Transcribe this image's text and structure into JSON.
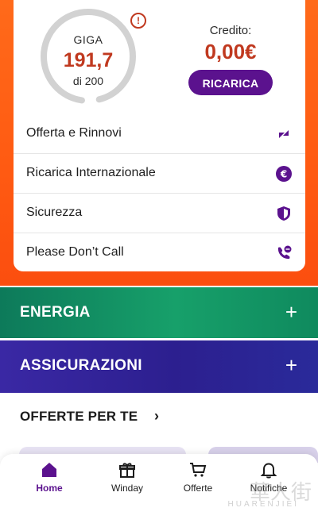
{
  "data_usage": {
    "label": "GIGA",
    "amount": "191,7",
    "total_label": "di 200",
    "used_fraction": 0.9585,
    "alert_icon": "alert-circle-icon"
  },
  "credit": {
    "label": "Credito:",
    "value": "0,00€",
    "button": "RICARICA"
  },
  "menu": [
    {
      "label": "Offerta e Rinnovi",
      "icon": "offer-renew-icon"
    },
    {
      "label": "Ricarica Internazionale",
      "icon": "euro-icon"
    },
    {
      "label": "Sicurezza",
      "icon": "shield-icon"
    },
    {
      "label": "Please Don’t Call",
      "icon": "phone-block-icon"
    }
  ],
  "sections": {
    "energy": {
      "title": "ENERGIA",
      "icon": "plus-icon"
    },
    "insurance": {
      "title": "ASSICURAZIONI",
      "icon": "plus-icon"
    }
  },
  "offers": {
    "title": "OFFERTE PER TE",
    "icon": "chevron-right-icon"
  },
  "nav": [
    {
      "label": "Home",
      "icon": "home-icon"
    },
    {
      "label": "Winday",
      "icon": "gift-icon"
    },
    {
      "label": "Offerte",
      "icon": "cart-icon"
    },
    {
      "label": "Notifiche",
      "icon": "bell-icon"
    }
  ],
  "colors": {
    "brand_orange": "#ff6a1a",
    "brand_purple": "#5b128e",
    "accent_red": "#c0391f",
    "energy_green": "#17a06a",
    "insurance_blue": "#3a28a4"
  },
  "watermark": {
    "glyphs": "華人街",
    "text": "HUARENJIEI"
  }
}
